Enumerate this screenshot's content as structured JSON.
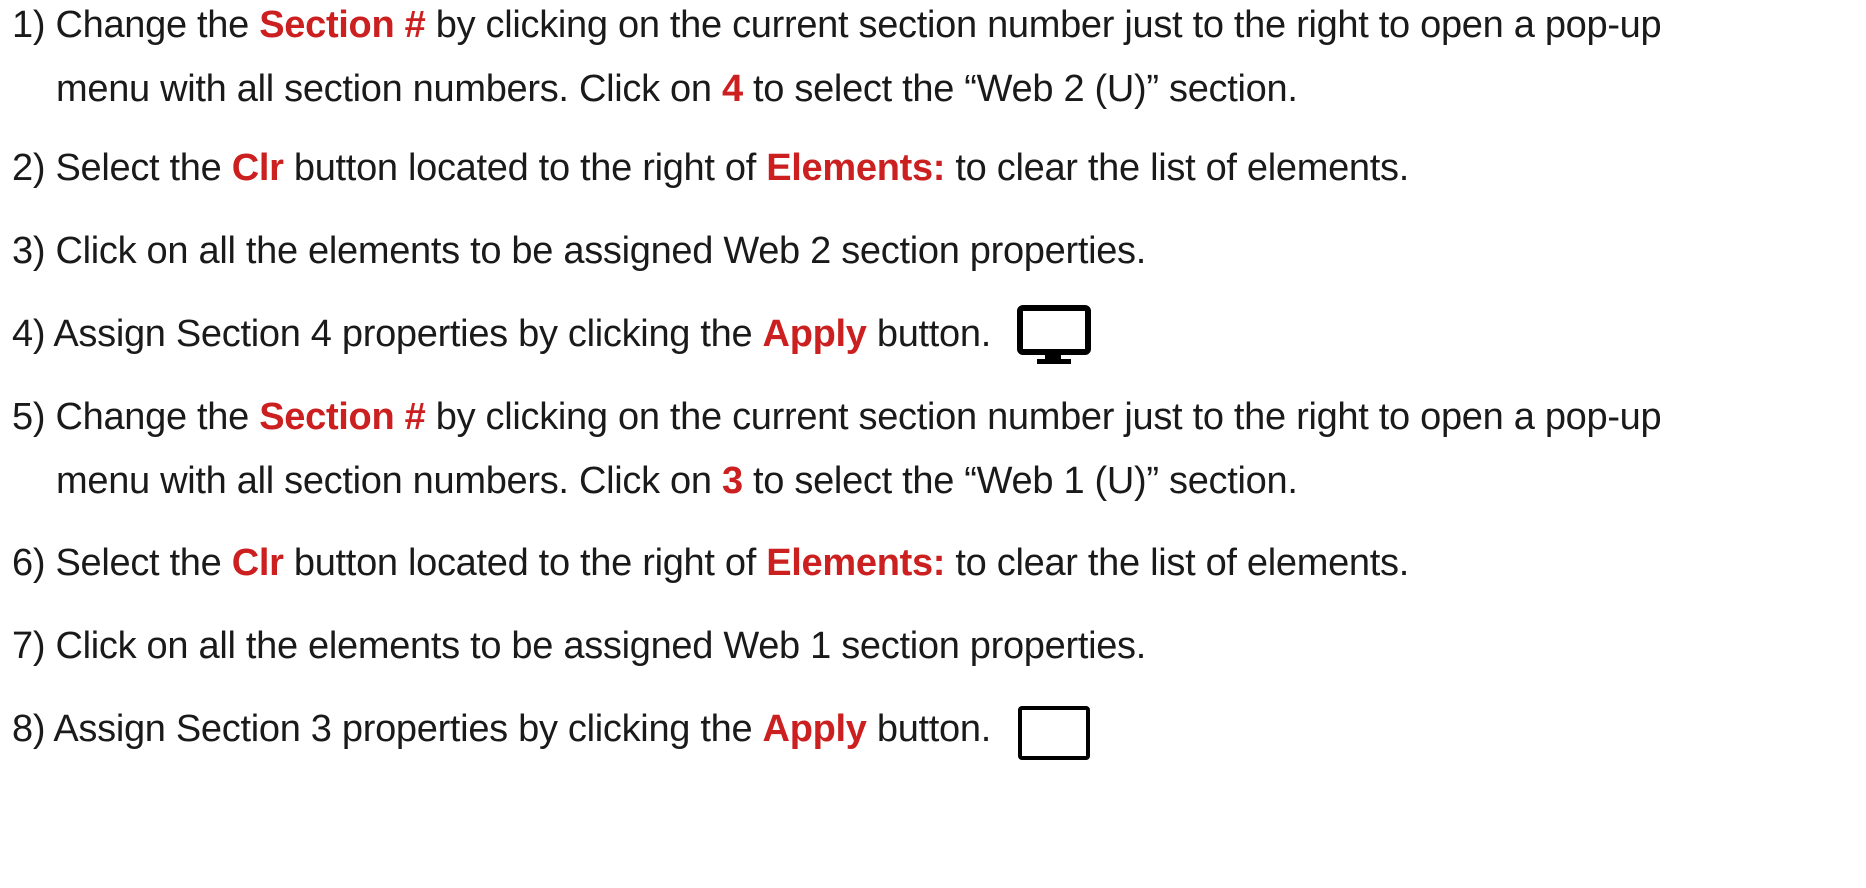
{
  "steps": [
    {
      "number": "1)",
      "parts": [
        "Change the ",
        "Section #",
        " by clicking on the current section number just to the right to open a pop-up"
      ],
      "continuation": [
        "menu with all section numbers. Click on ",
        "4",
        " to select the “Web 2 (U)” section."
      ]
    },
    {
      "number": "2)",
      "parts": [
        "Select the ",
        "Clr",
        " button located to the right of ",
        "Elements:",
        " to clear the list of elements."
      ]
    },
    {
      "number": "3)",
      "parts": [
        "Click on all the elements to be assigned Web 2 section properties."
      ]
    },
    {
      "number": "4)",
      "parts": [
        "Assign Section 4 properties by clicking the ",
        "Apply",
        " button."
      ],
      "icon": "monitor-icon"
    },
    {
      "number": "5)",
      "parts": [
        "Change the ",
        "Section #",
        " by clicking on the current section number just to the right to open a pop-up"
      ],
      "continuation": [
        "menu with all section numbers. Click on ",
        "3",
        " to select the “Web 1 (U)” section."
      ]
    },
    {
      "number": "6)",
      "parts": [
        "Select the ",
        "Clr",
        " button located to the right of ",
        "Elements:",
        " to clear the list of elements."
      ]
    },
    {
      "number": "7)",
      "parts": [
        "Click on all the elements to be assigned Web 1 section properties."
      ]
    },
    {
      "number": "8)",
      "parts": [
        "Assign Section 3 properties by clicking the ",
        "Apply",
        " button."
      ],
      "icon": "empty-box-icon"
    }
  ],
  "colors": {
    "highlight": "#cc1f1f",
    "text": "#1a1a1a"
  }
}
